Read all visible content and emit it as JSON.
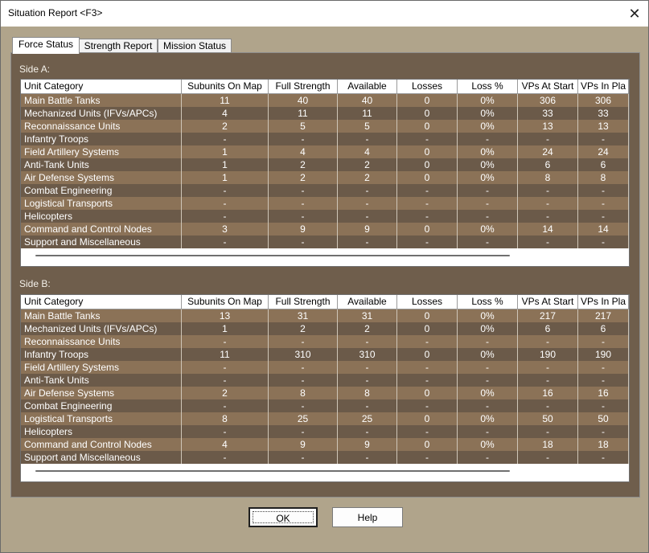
{
  "window": {
    "title": "Situation Report <F3>",
    "close_symbol": "✕"
  },
  "tabs": [
    "Force Status",
    "Strength Report",
    "Mission Status"
  ],
  "active_tab": 0,
  "columns": [
    "Unit Category",
    "Subunits On Map",
    "Full Strength",
    "Available",
    "Losses",
    "Loss %",
    "VPs At Start",
    "VPs In Pla"
  ],
  "sides": [
    {
      "label": "Side A:",
      "rows": [
        [
          "Main Battle Tanks",
          "11",
          "40",
          "40",
          "0",
          "0%",
          "306",
          "306"
        ],
        [
          "Mechanized Units (IFVs/APCs)",
          "4",
          "11",
          "11",
          "0",
          "0%",
          "33",
          "33"
        ],
        [
          "Reconnaissance Units",
          "2",
          "5",
          "5",
          "0",
          "0%",
          "13",
          "13"
        ],
        [
          "Infantry Troops",
          "-",
          "-",
          "-",
          "-",
          "-",
          "-",
          "-"
        ],
        [
          "Field Artillery Systems",
          "1",
          "4",
          "4",
          "0",
          "0%",
          "24",
          "24"
        ],
        [
          "Anti-Tank Units",
          "1",
          "2",
          "2",
          "0",
          "0%",
          "6",
          "6"
        ],
        [
          "Air Defense Systems",
          "1",
          "2",
          "2",
          "0",
          "0%",
          "8",
          "8"
        ],
        [
          "Combat Engineering",
          "-",
          "-",
          "-",
          "-",
          "-",
          "-",
          "-"
        ],
        [
          "Logistical Transports",
          "-",
          "-",
          "-",
          "-",
          "-",
          "-",
          "-"
        ],
        [
          "Helicopters",
          "-",
          "-",
          "-",
          "-",
          "-",
          "-",
          "-"
        ],
        [
          "Command and Control Nodes",
          "3",
          "9",
          "9",
          "0",
          "0%",
          "14",
          "14"
        ],
        [
          "Support and Miscellaneous",
          "-",
          "-",
          "-",
          "-",
          "-",
          "-",
          "-"
        ]
      ]
    },
    {
      "label": "Side B:",
      "rows": [
        [
          "Main Battle Tanks",
          "13",
          "31",
          "31",
          "0",
          "0%",
          "217",
          "217"
        ],
        [
          "Mechanized Units (IFVs/APCs)",
          "1",
          "2",
          "2",
          "0",
          "0%",
          "6",
          "6"
        ],
        [
          "Reconnaissance Units",
          "-",
          "-",
          "-",
          "-",
          "-",
          "-",
          "-"
        ],
        [
          "Infantry Troops",
          "11",
          "310",
          "310",
          "0",
          "0%",
          "190",
          "190"
        ],
        [
          "Field Artillery Systems",
          "-",
          "-",
          "-",
          "-",
          "-",
          "-",
          "-"
        ],
        [
          "Anti-Tank Units",
          "-",
          "-",
          "-",
          "-",
          "-",
          "-",
          "-"
        ],
        [
          "Air Defense Systems",
          "2",
          "8",
          "8",
          "0",
          "0%",
          "16",
          "16"
        ],
        [
          "Combat Engineering",
          "-",
          "-",
          "-",
          "-",
          "-",
          "-",
          "-"
        ],
        [
          "Logistical Transports",
          "8",
          "25",
          "25",
          "0",
          "0%",
          "50",
          "50"
        ],
        [
          "Helicopters",
          "-",
          "-",
          "-",
          "-",
          "-",
          "-",
          "-"
        ],
        [
          "Command and Control Nodes",
          "4",
          "9",
          "9",
          "0",
          "0%",
          "18",
          "18"
        ],
        [
          "Support and Miscellaneous",
          "-",
          "-",
          "-",
          "-",
          "-",
          "-",
          "-"
        ]
      ]
    }
  ],
  "buttons": {
    "ok": "OK",
    "help": "Help"
  }
}
